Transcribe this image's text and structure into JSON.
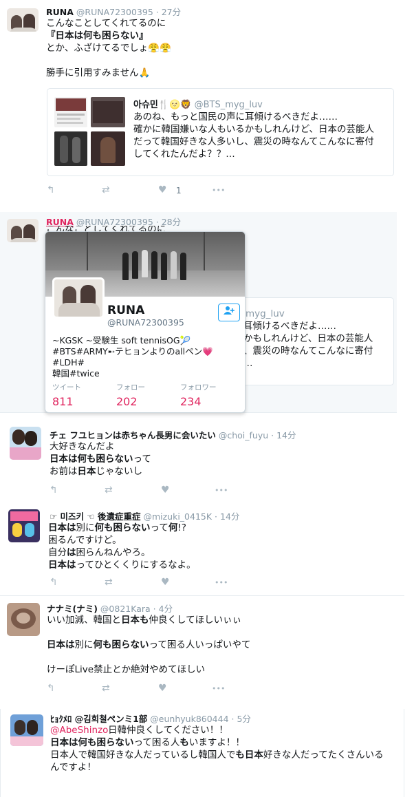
{
  "tweets": [
    {
      "name": "RUNA",
      "handle": "@RUNA72300395",
      "time": "27分",
      "lines": [
        [
          {
            "t": "こんなことしてくれてるのに"
          }
        ],
        [
          {
            "t": "『日本は何も困らない』",
            "b": true
          }
        ],
        [
          {
            "t": "とか、ふざけてるでしょ😤😤"
          }
        ],
        [],
        [
          {
            "t": "勝手に引用すみません🙏"
          }
        ]
      ],
      "quote": {
        "name": "아슈민🍴🌝🦁",
        "handle": "@BTS_myg_luv",
        "lines": [
          "あのね、もっと国民の声に耳傾けるべきだよ……",
          "確かに韓国嫌いな人もいるかもしれんけど、日本の芸能人",
          "だって韓国好きな人多いし、震災の時なんてこんなに寄付",
          "してくれたんだよ？？…"
        ]
      },
      "like_count": "1"
    },
    {
      "name": "RUNA",
      "handle": "@RUNA72300395",
      "time": "28分",
      "partial_text": "こんなことしてくれてるのに",
      "quote_fragments": [
        "myg_luv",
        "耳傾けるべきだよ……",
        "かもしれんけど、日本の芸能人",
        "、震災の時なんてこんなに寄付",
        "…"
      ]
    },
    {
      "name": "チェ フユヒョンは赤ちゃん長男に会いたい",
      "handle": "@choi_fuyu",
      "time": "14分",
      "lines": [
        [
          {
            "t": "大好きなんだよ"
          }
        ],
        [
          {
            "t": "日本は何も困らない",
            "b": true
          },
          {
            "t": "って"
          }
        ],
        [
          {
            "t": "お前は"
          },
          {
            "t": "日本",
            "b": true
          },
          {
            "t": "じゃないし"
          }
        ]
      ]
    },
    {
      "name": "☞ 미즈키 ☜ 後遺症重症",
      "handle": "@mizuki_0415K",
      "time": "14分",
      "lines": [
        [
          {
            "t": "日本は",
            "b": true
          },
          {
            "t": "別に"
          },
          {
            "t": "何も困らない",
            "b": true
          },
          {
            "t": "って"
          },
          {
            "t": "何",
            "b": true
          },
          {
            "t": "!?"
          }
        ],
        [
          {
            "t": "困るんですけど。"
          }
        ],
        [
          {
            "t": "自分"
          },
          {
            "t": "は",
            "b": true
          },
          {
            "t": "困らんねんやろ。"
          }
        ],
        [
          {
            "t": "日本は",
            "b": true
          },
          {
            "t": "ってひとくくりにするなよ。"
          }
        ]
      ]
    },
    {
      "name": "ナナミ(ナミ)",
      "handle": "@0821Kara",
      "time": "4分",
      "lines": [
        [
          {
            "t": "いい加減、韓国と"
          },
          {
            "t": "日本も",
            "b": true
          },
          {
            "t": "仲良くしてほしいぃぃ"
          }
        ],
        [],
        [
          {
            "t": "日本は",
            "b": true
          },
          {
            "t": "別に"
          },
          {
            "t": "何も困らない",
            "b": true
          },
          {
            "t": "って困る人いっぱいやて"
          }
        ],
        [],
        [
          {
            "t": "けーぽLive禁止とか絶対やめてほしい"
          }
        ]
      ]
    },
    {
      "name": "ﾋｮｸﾒﾛ @김희철ペンミ1部",
      "handle": "@eunhyuk860444",
      "time": "5分",
      "mention": "@AbeShinzo",
      "lines": [
        [
          {
            "t": "日韓仲良くしてください！！"
          }
        ],
        [
          {
            "t": "日本は何も困らない",
            "b": true
          },
          {
            "t": "って困る人"
          },
          {
            "t": "も",
            "b": true
          },
          {
            "t": "いますよ！！"
          }
        ],
        [
          {
            "t": "日本人で韓国好きな人だっているし韓国人で"
          },
          {
            "t": "も日本",
            "b": true
          },
          {
            "t": "好きな人だってたくさんいる"
          }
        ],
        [
          {
            "t": "んですよ！"
          }
        ]
      ]
    }
  ],
  "profile_card": {
    "name": "RUNA",
    "handle": "@RUNA72300395",
    "bio_lines": [
      "~KGSK ~受験生 soft tennisOG🎾",
      "#BTS#ARMY➸テヒョンよりのallペン💗 #LDH#",
      "韓国#twice"
    ],
    "stats": [
      {
        "label": "ツイート",
        "value": "811"
      },
      {
        "label": "フォロー",
        "value": "202"
      },
      {
        "label": "フォロワー",
        "value": "234"
      }
    ],
    "follow_icon": "add-user-icon"
  },
  "icons": {
    "reply": "↰",
    "retweet": "⇄",
    "like": "♥",
    "more": "•••"
  },
  "colors": {
    "accent": "#1da1f2",
    "stat_value": "#e0245e",
    "muted": "#8899a6",
    "name_hover": "#e0245e"
  }
}
